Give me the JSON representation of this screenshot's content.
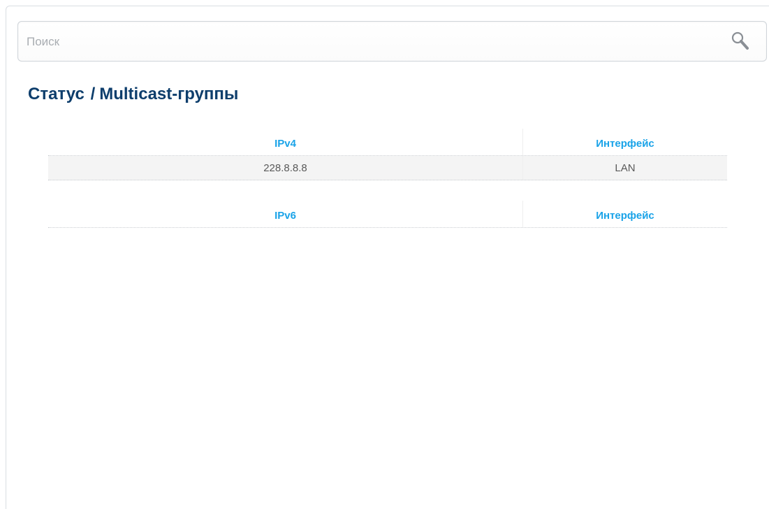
{
  "search": {
    "placeholder": "Поиск",
    "value": ""
  },
  "breadcrumb": {
    "section": "Статус",
    "separator": "/",
    "page": "Multicast-группы"
  },
  "ipv4_table": {
    "headers": [
      "IPv4",
      "Интерфейс"
    ],
    "rows": [
      [
        "228.8.8.8",
        "LAN"
      ]
    ]
  },
  "ipv6_table": {
    "headers": [
      "IPv6",
      "Интерфейс"
    ],
    "rows": []
  },
  "colors": {
    "title": "#0e3e6c",
    "header_accent": "#1aa3e8",
    "row_background": "#f4f4f4"
  },
  "icons": {
    "search": "search-icon"
  }
}
